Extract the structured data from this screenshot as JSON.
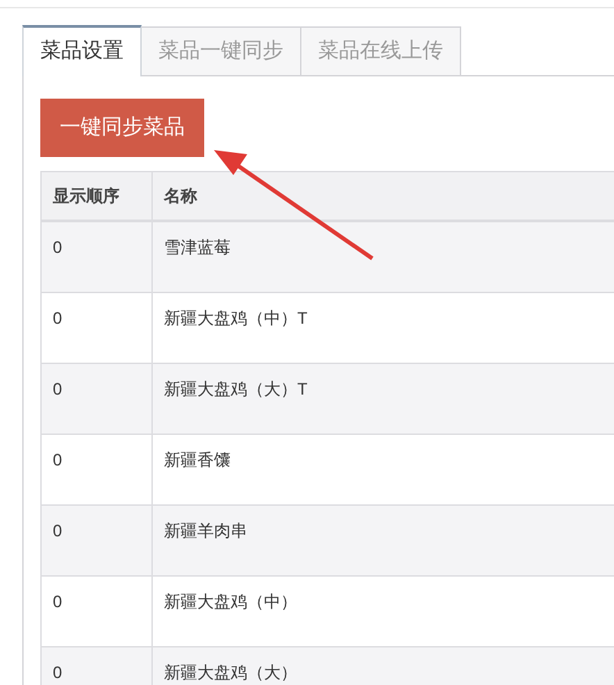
{
  "tabs": [
    {
      "label": "菜品设置",
      "selected": true
    },
    {
      "label": "菜品一键同步",
      "selected": false
    },
    {
      "label": "菜品在线上传",
      "selected": false
    }
  ],
  "sync_button": "一键同步菜品",
  "table": {
    "columns": [
      "显示顺序",
      "名称"
    ],
    "rows": [
      [
        "0",
        "雪津蓝莓"
      ],
      [
        "0",
        "新疆大盘鸡（中）T"
      ],
      [
        "0",
        "新疆大盘鸡（大）T"
      ],
      [
        "0",
        "新疆香馕"
      ],
      [
        "0",
        "新疆羊肉串"
      ],
      [
        "0",
        "新疆大盘鸡（中）"
      ],
      [
        "0",
        "新疆大盘鸡（大）"
      ]
    ]
  }
}
